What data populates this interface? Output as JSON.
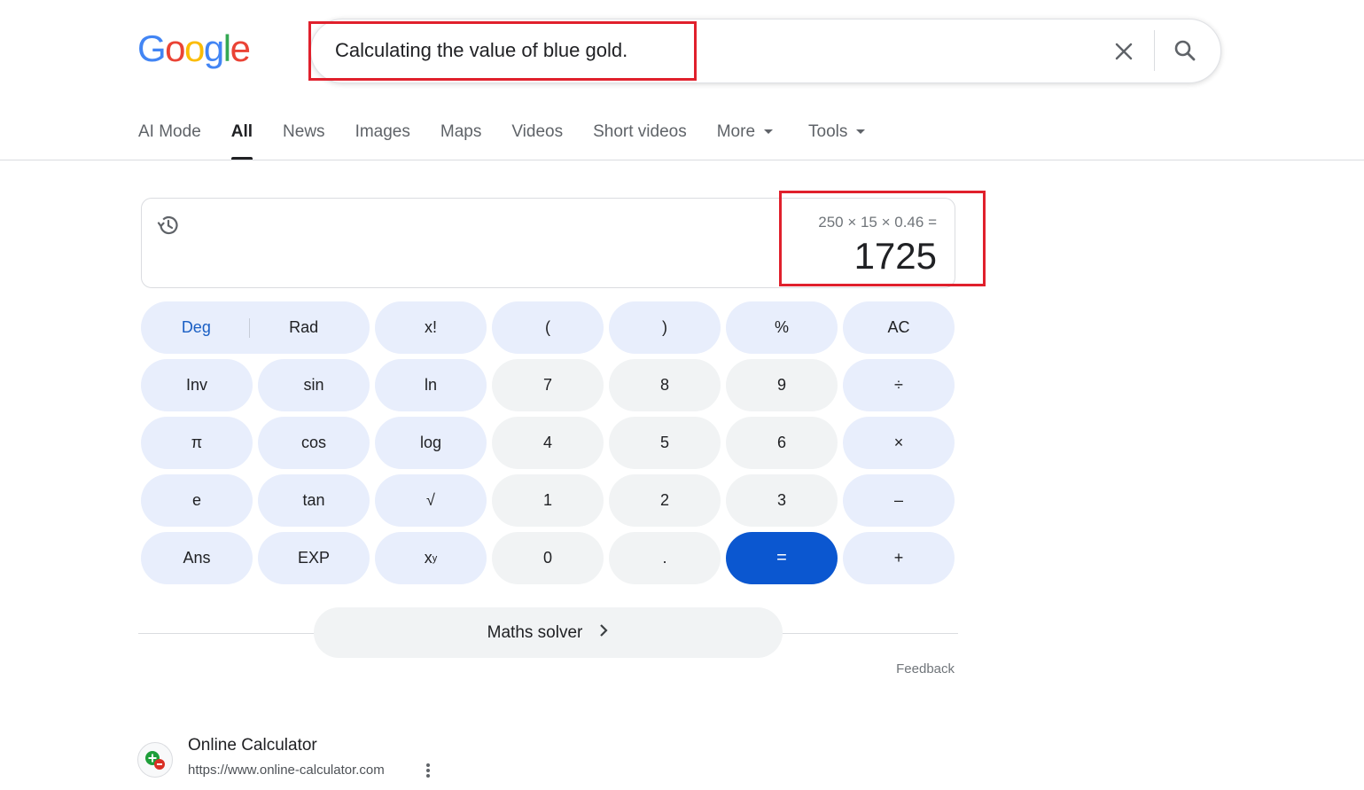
{
  "logo": {
    "letters": [
      "G",
      "o",
      "o",
      "g",
      "l",
      "e"
    ],
    "colors": [
      "#4285f4",
      "#ea4335",
      "#fbbc05",
      "#4285f4",
      "#34a853",
      "#ea4335"
    ]
  },
  "search": {
    "query": "Calculating the value of blue gold.",
    "clear_icon": "close-icon",
    "search_icon": "search-icon"
  },
  "tabs": [
    {
      "label": "AI Mode"
    },
    {
      "label": "All"
    },
    {
      "label": "News"
    },
    {
      "label": "Images"
    },
    {
      "label": "Maps"
    },
    {
      "label": "Videos"
    },
    {
      "label": "Short videos"
    },
    {
      "label": "More"
    },
    {
      "label": "Tools"
    }
  ],
  "calculator": {
    "expression": "250 × 15 × 0.46 =",
    "result": "1725",
    "keys": {
      "deg": "Deg",
      "rad": "Rad",
      "fact": "x!",
      "lparen": "(",
      "rparen": ")",
      "percent": "%",
      "ac": "AC",
      "inv": "Inv",
      "sin": "sin",
      "ln": "ln",
      "n7": "7",
      "n8": "8",
      "n9": "9",
      "div": "÷",
      "pi": "π",
      "cos": "cos",
      "log": "log",
      "n4": "4",
      "n5": "5",
      "n6": "6",
      "mul": "×",
      "e": "e",
      "tan": "tan",
      "sqrt": "√",
      "n1": "1",
      "n2": "2",
      "n3": "3",
      "sub": "–",
      "ans": "Ans",
      "exp": "EXP",
      "pow_base": "x",
      "pow_exp": "y",
      "n0": "0",
      "dot": ".",
      "eq": "=",
      "add": "+"
    }
  },
  "solver": {
    "label": "Maths solver"
  },
  "feedback": "Feedback",
  "result": {
    "title": "Online Calculator",
    "url": "https://www.online-calculator.com"
  },
  "colors": {
    "accent": "#0b57d0",
    "highlight": "#e0202c",
    "fn_key": "#e8eefc",
    "num_key": "#f1f3f4"
  }
}
